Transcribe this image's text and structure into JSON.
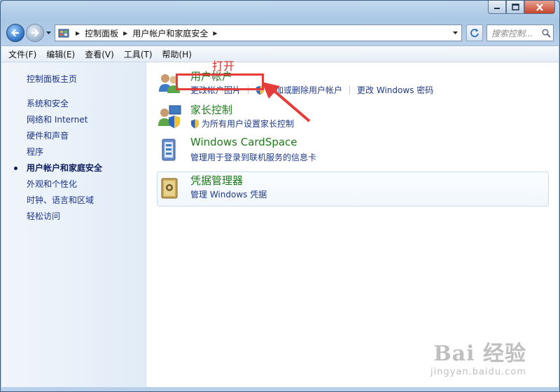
{
  "window": {
    "caption_buttons": [
      "minimize-icon",
      "maximize-icon",
      "close-icon"
    ]
  },
  "address": {
    "crumbs": [
      "控制面板",
      "用户帐户和家庭安全"
    ],
    "search_placeholder": "搜索控制..."
  },
  "menu": {
    "items": [
      "文件(F)",
      "编辑(E)",
      "查看(V)",
      "工具(T)",
      "帮助(H)"
    ]
  },
  "sidebar": {
    "home": "控制面板主页",
    "items": [
      {
        "label": "系统和安全",
        "current": false
      },
      {
        "label": "网络和 Internet",
        "current": false
      },
      {
        "label": "硬件和声音",
        "current": false
      },
      {
        "label": "程序",
        "current": false
      },
      {
        "label": "用户帐户和家庭安全",
        "current": true
      },
      {
        "label": "外观和个性化",
        "current": false
      },
      {
        "label": "时钟、语言和区域",
        "current": false
      },
      {
        "label": "轻松访问",
        "current": false
      }
    ]
  },
  "categories": [
    {
      "title": "用户帐户",
      "icon": "users-icon",
      "links": [
        {
          "label": "更改帐户图片",
          "shield": false
        },
        {
          "label": "添加或删除用户帐户",
          "shield": true
        },
        {
          "label": "更改 Windows 密码",
          "shield": false
        }
      ]
    },
    {
      "title": "家长控制",
      "icon": "parental-control-icon",
      "links": [
        {
          "label": "为所有用户设置家长控制",
          "shield": true
        }
      ]
    },
    {
      "title": "Windows CardSpace",
      "icon": "cardspace-icon",
      "links": [
        {
          "label": "管理用于登录到联机服务的信息卡",
          "shield": false
        }
      ]
    },
    {
      "title": "凭据管理器",
      "icon": "credential-manager-icon",
      "links": [
        {
          "label": "管理 Windows 凭据",
          "shield": false
        }
      ]
    }
  ],
  "annotation": {
    "text": "打开",
    "color": "#e33c39"
  },
  "watermark": {
    "logo": "Bai 经验",
    "url": "jingyan.baidu.com"
  }
}
